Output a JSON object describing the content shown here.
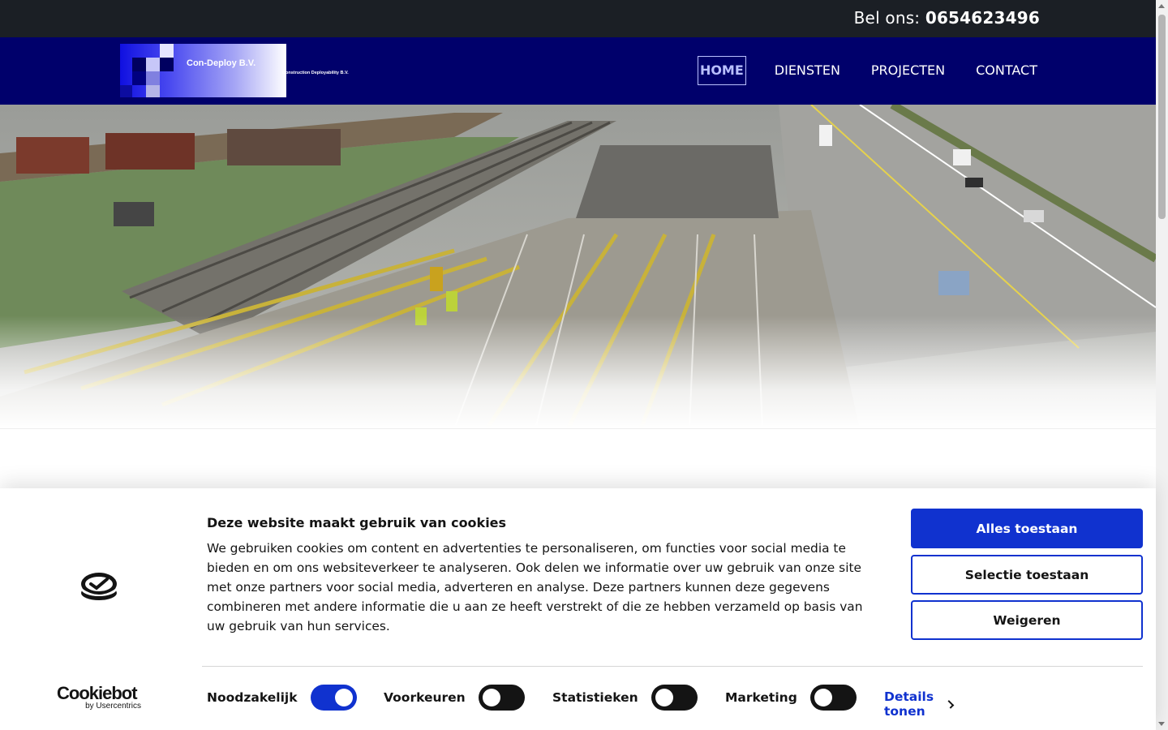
{
  "topbar": {
    "call_label": "Bel ons:",
    "phone": "0654623496"
  },
  "logo": {
    "title": "Con-Deploy B.V.",
    "subtitle": "Construction Deployability B.V."
  },
  "nav": {
    "items": [
      {
        "label": "HOME",
        "active": true
      },
      {
        "label": "DIENSTEN",
        "active": false
      },
      {
        "label": "PROJECTEN",
        "active": false
      },
      {
        "label": "CONTACT",
        "active": false
      }
    ]
  },
  "hero": {
    "image": "construction-site-photo",
    "description_icon": "photo"
  },
  "cookie": {
    "title": "Deze website maakt gebruik van cookies",
    "text": "We gebruiken cookies om content en advertenties te personaliseren, om functies voor social media te bieden en om ons websiteverkeer te analyseren. Ook delen we informatie over uw gebruik van onze site met onze partners voor social media, adverteren en analyse. Deze partners kunnen deze gegevens combineren met andere informatie die u aan ze heeft verstrekt of die ze hebben verzameld op basis van uw gebruik van hun services.",
    "buttons": {
      "allow_all": "Alles toestaan",
      "allow_selection": "Selectie toestaan",
      "deny": "Weigeren"
    },
    "toggles": [
      {
        "label": "Noodzakelijk",
        "on": true
      },
      {
        "label": "Voorkeuren",
        "on": false
      },
      {
        "label": "Statistieken",
        "on": false
      },
      {
        "label": "Marketing",
        "on": false
      }
    ],
    "details_label": "Details tonen",
    "brand": {
      "name": "Cookiebot",
      "by": "by Usercentrics"
    },
    "accent_color": "#1032cf"
  },
  "colors": {
    "topbar": "#1b1f25",
    "nav": "#00006b",
    "active_nav": "#b9c0ff"
  }
}
